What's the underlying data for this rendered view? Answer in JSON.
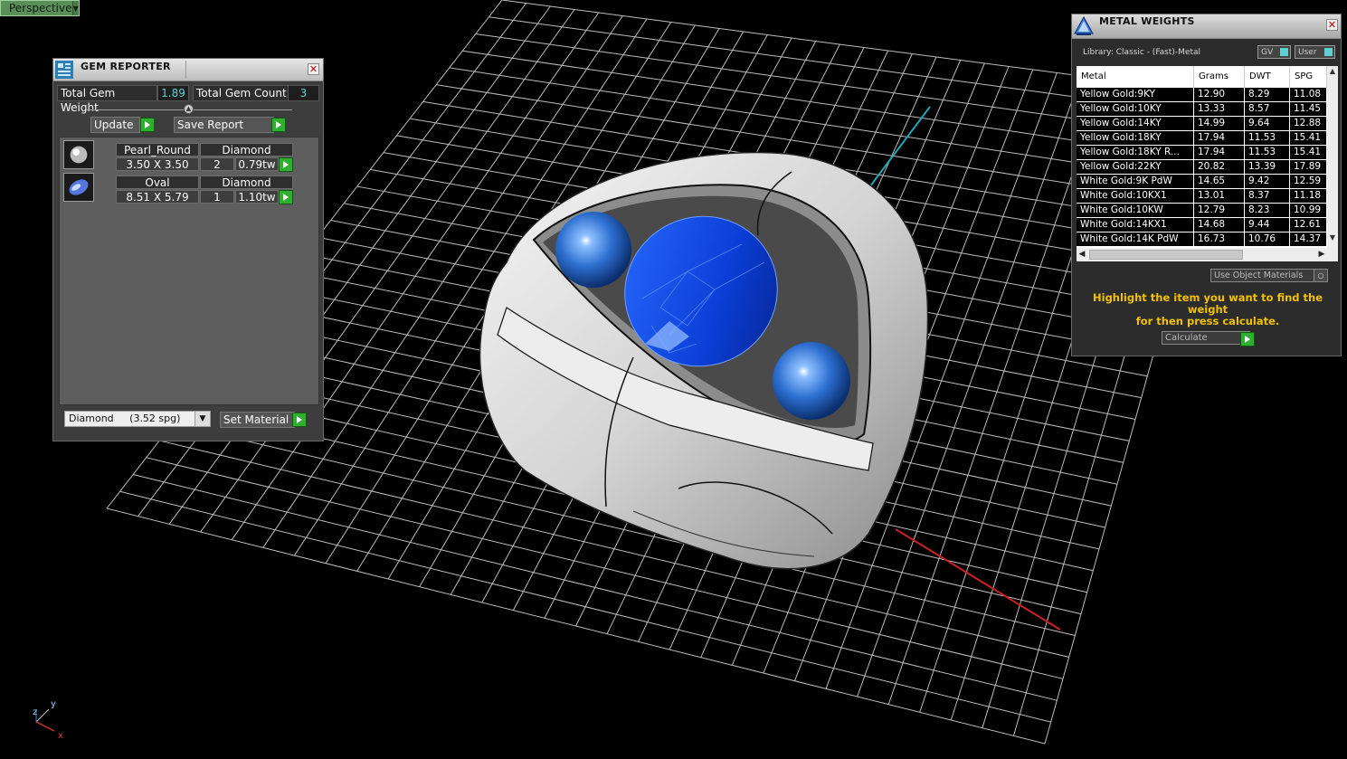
{
  "viewport": {
    "label": "Perspective"
  },
  "gem_reporter": {
    "title": "GEM REPORTER",
    "total_weight_label": "Total Gem Weight",
    "total_weight_value": "1.89",
    "total_count_label": "Total Gem Count",
    "total_count_value": "3",
    "update_label": "Update",
    "save_report_label": "Save Report",
    "gems": [
      {
        "shape": "Pearl_Round",
        "size": "3.50 X 3.50",
        "material": "Diamond",
        "count": "2",
        "weight": "0.79tw"
      },
      {
        "shape": "Oval",
        "size": "8.51 X 5.79",
        "material": "Diamond",
        "count": "1",
        "weight": "1.10tw"
      }
    ],
    "material_select": "Diamond     (3.52 spg)",
    "set_material_label": "Set Material"
  },
  "metal_weights": {
    "title": "METAL WEIGHTS",
    "library": "Library: Classic - (Fast)-Metal",
    "toggle_gv": "GV",
    "toggle_user": "User",
    "columns": [
      "Metal",
      "Grams",
      "DWT",
      "SPG"
    ],
    "rows": [
      [
        "Yellow Gold:9KY",
        "12.90",
        "8.29",
        "11.08"
      ],
      [
        "Yellow Gold:10KY",
        "13.33",
        "8.57",
        "11.45"
      ],
      [
        "Yellow Gold:14KY",
        "14.99",
        "9.64",
        "12.88"
      ],
      [
        "Yellow Gold:18KY",
        "17.94",
        "11.53",
        "15.41"
      ],
      [
        "Yellow Gold:18KY R...",
        "17.94",
        "11.53",
        "15.41"
      ],
      [
        "Yellow Gold:22KY",
        "20.82",
        "13.39",
        "17.89"
      ],
      [
        "White Gold:9K PdW",
        "14.65",
        "9.42",
        "12.59"
      ],
      [
        "White Gold:10KX1",
        "13.01",
        "8.37",
        "11.18"
      ],
      [
        "White Gold:10KW",
        "12.79",
        "8.23",
        "10.99"
      ],
      [
        "White Gold:14KX1",
        "14.68",
        "9.44",
        "12.61"
      ],
      [
        "White Gold:14K PdW",
        "16.73",
        "10.76",
        "14.37"
      ]
    ],
    "use_object_materials": "Use Object Materials",
    "hint_line1": "Highlight the item you want to find the weight",
    "hint_line2": "for then press calculate.",
    "calculate_label": "Calculate"
  },
  "axis_labels": {
    "x": "x",
    "y": "y",
    "z": "z"
  }
}
